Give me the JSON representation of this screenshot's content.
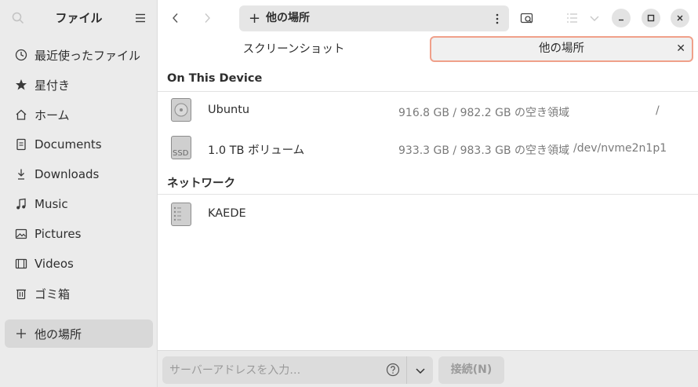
{
  "sidebar": {
    "title": "ファイル",
    "items": [
      {
        "label": "最近使ったファイル",
        "icon": "clock-icon"
      },
      {
        "label": "星付き",
        "icon": "star-icon"
      },
      {
        "label": "ホーム",
        "icon": "home-icon"
      },
      {
        "label": "Documents",
        "icon": "document-icon"
      },
      {
        "label": "Downloads",
        "icon": "download-icon"
      },
      {
        "label": "Music",
        "icon": "music-icon"
      },
      {
        "label": "Pictures",
        "icon": "picture-icon"
      },
      {
        "label": "Videos",
        "icon": "video-icon"
      },
      {
        "label": "ゴミ箱",
        "icon": "trash-icon"
      }
    ],
    "other_locations": "他の場所"
  },
  "header": {
    "path_label": "他の場所"
  },
  "tabs": [
    {
      "label": "スクリーンショット",
      "active": false
    },
    {
      "label": "他の場所",
      "active": true
    }
  ],
  "sections": {
    "device_title": "On This Device",
    "network_title": "ネットワーク"
  },
  "devices": [
    {
      "name": "Ubuntu",
      "space": "916.8 GB / 982.2 GB の空き領域",
      "path": "/"
    },
    {
      "name": "1.0 TB ボリューム",
      "space": "933.3 GB / 983.3 GB の空き領域",
      "path": "/dev/nvme2n1p1",
      "icon_text": "SSD"
    }
  ],
  "network": [
    {
      "name": "KAEDE"
    }
  ],
  "bottom": {
    "address_placeholder": "サーバーアドレスを入力…",
    "connect_label": "接続(N)"
  },
  "colors": {
    "accent_border": "#f0a08a",
    "sidebar_bg": "#ebebeb"
  }
}
